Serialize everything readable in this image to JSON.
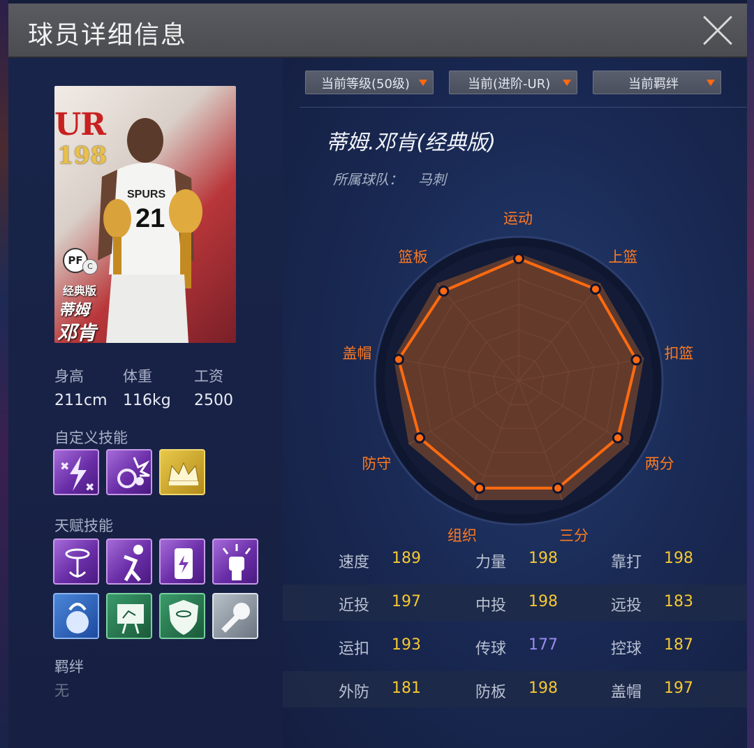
{
  "window": {
    "title": "球员详细信息"
  },
  "card": {
    "grade": "UR",
    "overall": "198",
    "position": "PF",
    "position_sub": "C",
    "edition": "经典版",
    "name_line1": "蒂姆",
    "name_line2": "邓肯"
  },
  "bio": {
    "height_label": "身高",
    "height_value": "211cm",
    "weight_label": "体重",
    "weight_value": "116kg",
    "salary_label": "工资",
    "salary_value": "2500"
  },
  "custom_skills": {
    "label": "自定义技能",
    "icons": [
      "lightning-crossed-icon",
      "dunk-burst-icon",
      "crown-icon"
    ]
  },
  "talent_skills": {
    "label": "天赋技能",
    "icons": [
      "hoop-anchor-icon",
      "shooter-icon",
      "energy-can-icon",
      "fist-burst-icon",
      "kettlebell-icon",
      "tactic-board-icon",
      "hoop-shield-icon",
      "tape-icon"
    ]
  },
  "bond": {
    "label": "羁绊",
    "value": "无"
  },
  "filters": {
    "level": "当前等级(50级)",
    "advance": "当前(进阶-UR)",
    "bond": "当前羁绊"
  },
  "player": {
    "name": "蒂姆.邓肯(经典版)",
    "team_label": "所属球队：",
    "team_value": "马刺"
  },
  "radar": {
    "accent": "#ff6a10",
    "axes": [
      "运动",
      "上篮",
      "扣篮",
      "两分",
      "三分",
      "组织",
      "防守",
      "盖帽",
      "篮板"
    ],
    "levels": [
      0.96,
      0.94,
      0.94,
      0.9,
      0.9,
      0.9,
      0.9,
      0.96,
      0.92
    ]
  },
  "attributes": [
    [
      {
        "label": "速度",
        "value": "189"
      },
      {
        "label": "力量",
        "value": "198"
      },
      {
        "label": "靠打",
        "value": "198"
      }
    ],
    [
      {
        "label": "近投",
        "value": "197"
      },
      {
        "label": "中投",
        "value": "198"
      },
      {
        "label": "远投",
        "value": "183"
      }
    ],
    [
      {
        "label": "运扣",
        "value": "193"
      },
      {
        "label": "传球",
        "value": "177"
      },
      {
        "label": "控球",
        "value": "187"
      }
    ],
    [
      {
        "label": "外防",
        "value": "181"
      },
      {
        "label": "防板",
        "value": "198"
      },
      {
        "label": "盖帽",
        "value": "197"
      }
    ]
  ]
}
